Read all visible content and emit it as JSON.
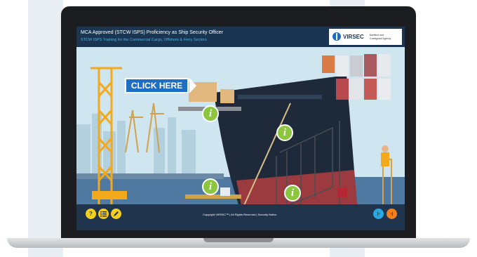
{
  "course": {
    "title": "MCA Approved (STCW ISPS) Proficiency as Ship Security Officer",
    "subtitle": "STCW ISPS Training for the Commercial Cargo, Offshore & Ferry Sectors"
  },
  "logos": {
    "virsec": "VIRSEC",
    "mca": "Maritime and Coastguard Agency"
  },
  "scene": {
    "click_here": "CLICK HERE",
    "info_glyph": "i"
  },
  "footer": {
    "copyright": "Copyright VIRSEC™ | All Rights Reserved | Security Notice",
    "help": "?",
    "prev": "|‹",
    "next": "›|"
  },
  "colors": {
    "accent_green": "#8cc63f",
    "click_blue": "#1e6fc1",
    "prev_blue": "#27a8e0",
    "next_orange": "#f0801e",
    "header_navy": "#1a3551"
  },
  "icons": [
    "help-icon",
    "menu-list-icon",
    "pencil-icon",
    "skip-back-icon",
    "skip-forward-icon",
    "info-icon"
  ]
}
